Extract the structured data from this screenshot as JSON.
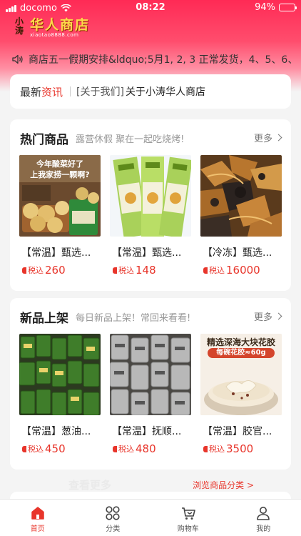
{
  "status_bar": {
    "carrier": "docomo",
    "time": "08:22",
    "battery": "94%",
    "battery_level": 0.94
  },
  "header": {
    "logo_mark": "小涛",
    "logo_name": "华人商店",
    "logo_url": "xiaotao8888.com",
    "brand_color": "#ff2a55"
  },
  "notice": {
    "icon": "speaker-icon",
    "text": "商店五一假期安排&ldquo;5月1, 2, 3 正常发货，4、5、6、"
  },
  "news": {
    "title_plain": "最新",
    "title_highlight": "资讯",
    "tag": "[关于我们]",
    "text": "关于小涛华人商店"
  },
  "hot_section": {
    "title": "热门商品",
    "subtitle": "露营休假 聚在一起吃烧烤!",
    "more": "更多",
    "products": [
      {
        "name": "【常温】甄选...",
        "price_label": "税込",
        "price": "260",
        "image": "pickled-cabbage-dumplings"
      },
      {
        "name": "【常温】甄选...",
        "price_label": "税込",
        "price": "148",
        "image": "dried-noodles-packs"
      },
      {
        "name": "【冷冻】甄选...",
        "price_label": "税込",
        "price": "16000",
        "image": "stir-fried-mushrooms"
      }
    ]
  },
  "new_section": {
    "title": "新品上架",
    "subtitle": "每日新品上架！常回来看看!",
    "more": "更多",
    "products": [
      {
        "name": "【常温】葱油...",
        "price_label": "税込",
        "price": "450",
        "image": "scallion-oil-packs"
      },
      {
        "name": "【常温】抚顺...",
        "price_label": "税込",
        "price": "480",
        "image": "fushun-silver-packs"
      },
      {
        "name": "【常温】胶官...",
        "price_label": "税込",
        "price": "3500",
        "image": "fish-maw-soup",
        "banner_title": "精选深海大块花胶",
        "banner_sub": "每碗花胶≈60g"
      }
    ]
  },
  "browse": {
    "ghost": "查看更多",
    "link": "浏览商品分类 >"
  },
  "tabbar": {
    "active_color": "#e8352b",
    "items": [
      {
        "label": "首页",
        "icon": "home-icon",
        "active": true
      },
      {
        "label": "分类",
        "icon": "grid-icon",
        "active": false
      },
      {
        "label": "购物车",
        "icon": "cart-icon",
        "active": false
      },
      {
        "label": "我的",
        "icon": "user-icon",
        "active": false
      }
    ]
  }
}
